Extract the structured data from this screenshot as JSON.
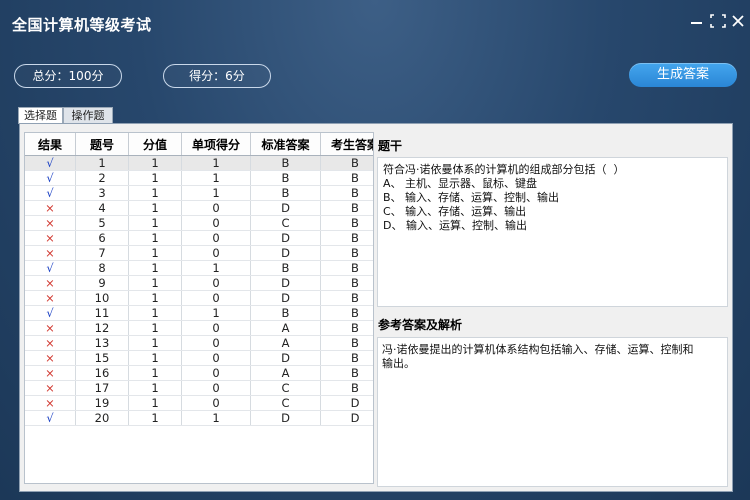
{
  "window": {
    "title": "全国计算机等级考试",
    "max_icon": "expand-icon",
    "close_icon": "close-icon"
  },
  "summary": {
    "total": "总分：100分",
    "score": "得分：6分",
    "generate_button": "生成答案"
  },
  "tabs": [
    "选择题",
    "操作题"
  ],
  "table": {
    "headers": [
      "结果",
      "题号",
      "分值",
      "单项得分",
      "标准答案",
      "考生答案"
    ],
    "rows": [
      [
        "√",
        "1",
        "1",
        "1",
        "B",
        "B"
      ],
      [
        "√",
        "2",
        "1",
        "1",
        "B",
        "B"
      ],
      [
        "√",
        "3",
        "1",
        "1",
        "B",
        "B"
      ],
      [
        "×",
        "4",
        "1",
        "0",
        "D",
        "B"
      ],
      [
        "×",
        "5",
        "1",
        "0",
        "C",
        "B"
      ],
      [
        "×",
        "6",
        "1",
        "0",
        "D",
        "B"
      ],
      [
        "×",
        "7",
        "1",
        "0",
        "D",
        "B"
      ],
      [
        "√",
        "8",
        "1",
        "1",
        "B",
        "B"
      ],
      [
        "×",
        "9",
        "1",
        "0",
        "D",
        "B"
      ],
      [
        "×",
        "10",
        "1",
        "0",
        "D",
        "B"
      ],
      [
        "√",
        "11",
        "1",
        "1",
        "B",
        "B"
      ],
      [
        "×",
        "12",
        "1",
        "0",
        "A",
        "B"
      ],
      [
        "×",
        "13",
        "1",
        "0",
        "A",
        "B"
      ],
      [
        "×",
        "15",
        "1",
        "0",
        "D",
        "B"
      ],
      [
        "×",
        "16",
        "1",
        "0",
        "A",
        "B"
      ],
      [
        "×",
        "17",
        "1",
        "0",
        "C",
        "B"
      ],
      [
        "×",
        "19",
        "1",
        "0",
        "C",
        "D"
      ],
      [
        "√",
        "20",
        "1",
        "1",
        "D",
        "D"
      ]
    ]
  },
  "question": {
    "title": "题干",
    "text": "符合冯·诺依曼体系的计算机的组成部分包括（  ）\nA、 主机、显示器、鼠标、键盘\nB、 输入、存储、运算、控制、输出\nC、 输入、存储、运算、输出\nD、 输入、运算、控制、输出"
  },
  "reference": {
    "title": "参考答案及解析",
    "text": "冯·诺依曼提出的计算机体系结构包括输入、存储、运算、控制和\n输出。"
  },
  "colors": {
    "correct": "#1a3fc4",
    "wrong": "#d0342c",
    "accent": "#2a86d6"
  }
}
